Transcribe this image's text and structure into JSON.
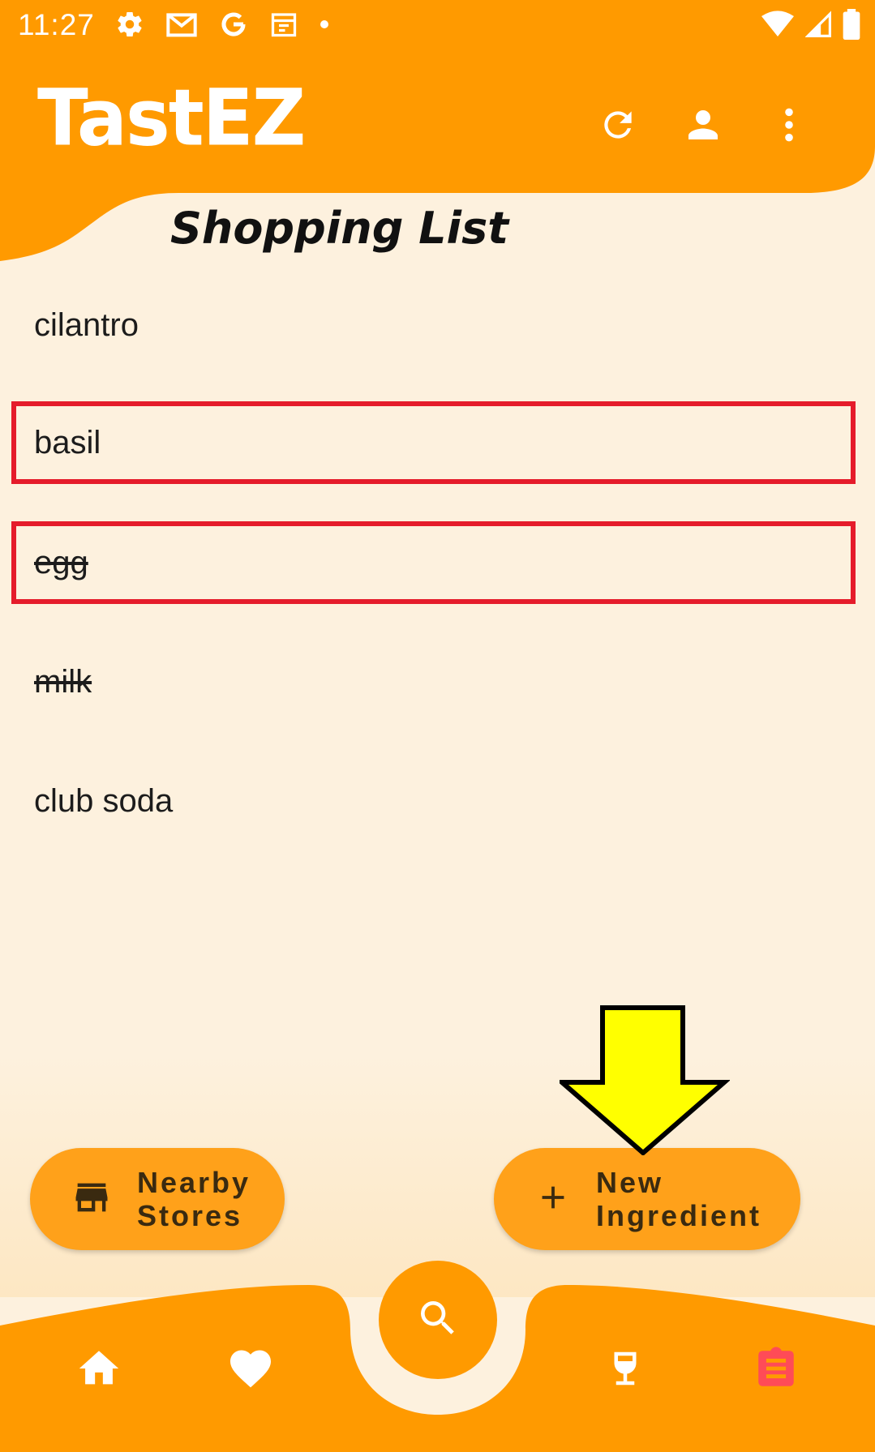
{
  "status_bar": {
    "time": "11:27",
    "left_icons": [
      "gear-icon",
      "gmail-icon",
      "google-icon",
      "calendar-icon",
      "dot-icon"
    ],
    "right_icons": [
      "wifi-icon",
      "signal-icon",
      "battery-icon"
    ]
  },
  "header": {
    "app_title": "TastEZ",
    "actions": [
      "refresh-icon",
      "account-icon",
      "more-vert-icon"
    ]
  },
  "page_title": "Shopping List",
  "shopping_list": [
    {
      "label": "cilantro",
      "checked": false,
      "highlighted": false
    },
    {
      "label": "basil",
      "checked": false,
      "highlighted": true
    },
    {
      "label": "egg",
      "checked": true,
      "highlighted": true
    },
    {
      "label": "milk",
      "checked": true,
      "highlighted": false
    },
    {
      "label": "club soda",
      "checked": false,
      "highlighted": false
    }
  ],
  "fabs": {
    "nearby_stores": {
      "label": "Nearby\nStores",
      "icon": "store-icon"
    },
    "new_ingredient": {
      "label": "New\nIngredient",
      "icon": "plus-icon"
    }
  },
  "bottom_nav": {
    "items": [
      "home-icon",
      "heart-icon",
      "search-icon",
      "glass-icon",
      "clipboard-icon"
    ],
    "active": "clipboard-icon"
  },
  "colors": {
    "primary": "#ff9a00",
    "background": "#fdf1de",
    "fab": "#ffa11a",
    "highlight_border": "#e51c2b",
    "active_nav": "#ff4b57",
    "annotation_arrow": "#ffff00"
  }
}
